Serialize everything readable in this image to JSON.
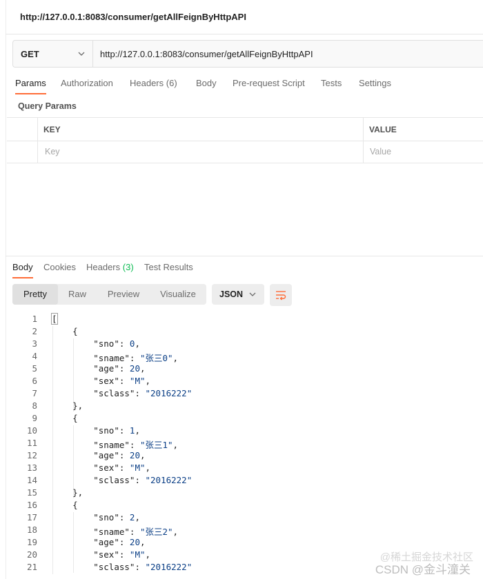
{
  "window": {
    "title": "http://127.0.0.1:8083/consumer/getAllFeignByHttpAPI"
  },
  "request": {
    "method": "GET",
    "url": "http://127.0.0.1:8083/consumer/getAllFeignByHttpAPI"
  },
  "request_tabs": [
    {
      "label": "Params",
      "active": true
    },
    {
      "label": "Authorization"
    },
    {
      "label": "Headers",
      "count": "(6)"
    },
    {
      "label": "Body"
    },
    {
      "label": "Pre-request Script"
    },
    {
      "label": "Tests"
    },
    {
      "label": "Settings"
    }
  ],
  "query_params": {
    "title": "Query Params",
    "columns": [
      "KEY",
      "VALUE"
    ],
    "key_placeholder": "Key",
    "value_placeholder": "Value"
  },
  "response_tabs": [
    {
      "label": "Body",
      "active": true
    },
    {
      "label": "Cookies"
    },
    {
      "label": "Headers",
      "count": "(3)"
    },
    {
      "label": "Test Results"
    }
  ],
  "view_modes": [
    "Pretty",
    "Raw",
    "Preview",
    "Visualize"
  ],
  "active_view_mode": "Pretty",
  "format": "JSON",
  "accent_color": "#ff6c37",
  "code_lines": [
    "[",
    "    {",
    "        \"sno\": 0,",
    "        \"sname\": \"张三0\",",
    "        \"age\": 20,",
    "        \"sex\": \"M\",",
    "        \"sclass\": \"2016222\"",
    "    },",
    "    {",
    "        \"sno\": 1,",
    "        \"sname\": \"张三1\",",
    "        \"age\": 20,",
    "        \"sex\": \"M\",",
    "        \"sclass\": \"2016222\"",
    "    },",
    "    {",
    "        \"sno\": 2,",
    "        \"sname\": \"张三2\",",
    "        \"age\": 20,",
    "        \"sex\": \"M\",",
    "        \"sclass\": \"2016222\""
  ],
  "watermark": {
    "line1": "@稀土掘金技术社区",
    "line2": "CSDN @金斗潼关"
  }
}
